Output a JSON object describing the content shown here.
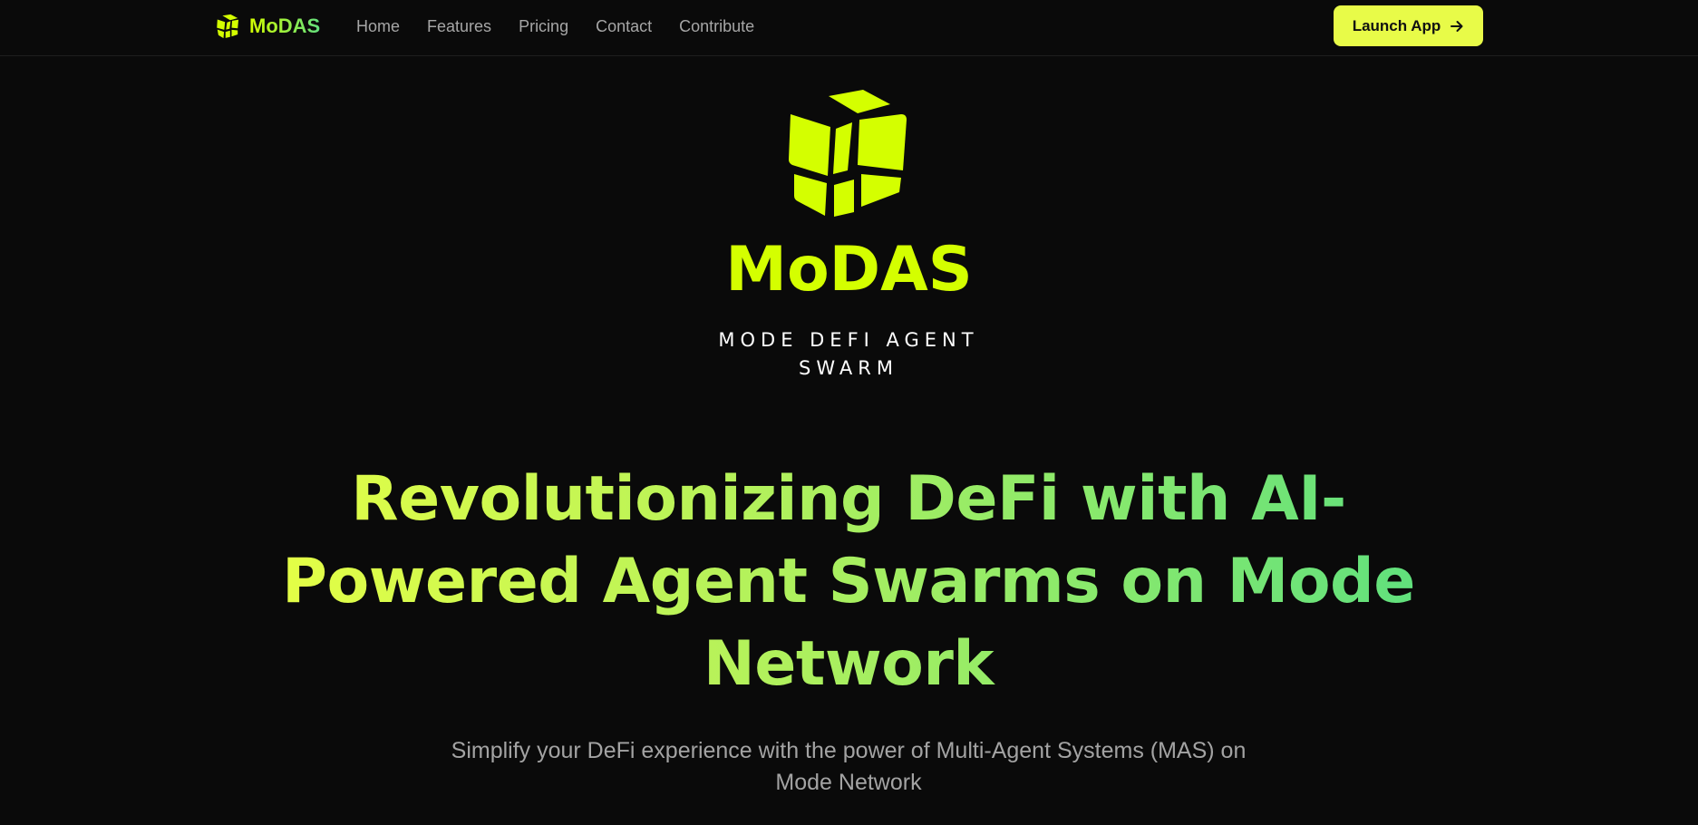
{
  "brand": {
    "name": "MoDAS",
    "icon": "cube-logo-icon"
  },
  "nav": {
    "items": [
      {
        "label": "Home"
      },
      {
        "label": "Features"
      },
      {
        "label": "Pricing"
      },
      {
        "label": "Contact"
      },
      {
        "label": "Contribute"
      }
    ]
  },
  "launch_button": {
    "label": "Launch App",
    "icon": "arrow-right-icon"
  },
  "hero": {
    "logo_icon": "cube-logo-icon",
    "title": "MoDAS",
    "subtitle": "MODE DEFI AGENT SWARM",
    "headline": "Revolutionizing DeFi with AI-Powered Agent Swarms on Mode Network",
    "description": "Simplify your DeFi experience with the power of Multi-Agent Systems (MAS) on Mode Network"
  },
  "colors": {
    "background": "#0a0a0a",
    "accent": "#d4ff00",
    "button": "#e8fb48",
    "gradient_end": "#5ee07e",
    "muted_text": "#a3a3a3"
  }
}
